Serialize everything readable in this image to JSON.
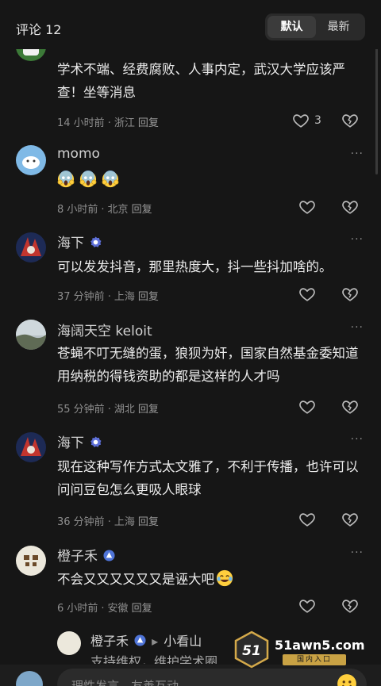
{
  "header": {
    "title": "评论 12",
    "sort_active": "默认",
    "sort_other": "最新"
  },
  "comments": [
    {
      "name": "",
      "text": "学术不端、经费腐败、人事内定，武汉大学应该严查！坐等消息",
      "time": "14 小时前",
      "location": "浙江",
      "reply": "回复",
      "likes": "3"
    },
    {
      "name": "momo",
      "text": "",
      "time": "8 小时前",
      "location": "北京",
      "reply": "回复",
      "emoji": [
        "scream-emoji",
        "scream-emoji",
        "scream-emoji"
      ]
    },
    {
      "name": "海下",
      "text": "可以发发抖音，那里热度大，抖一些抖加啥的。",
      "time": "37 分钟前",
      "location": "上海",
      "reply": "回复"
    },
    {
      "name": "海阔天空 keloit",
      "text": "苍蝇不叮无缝的蛋，狼狈为奸，国家自然基金委知道用纳税的得钱资助的都是这样的人才吗",
      "time": "55 分钟前",
      "location": "湖北",
      "reply": "回复"
    },
    {
      "name": "海下",
      "text": "现在这种写作方式太文雅了，不利于传播，也许可以问问豆包怎么更吸人眼球",
      "time": "36 分钟前",
      "location": "上海",
      "reply": "回复"
    },
    {
      "name": "橙子禾",
      "text": "不会又又又又又又是诬大吧",
      "time": "6 小时前",
      "location": "安徽",
      "reply": "回复",
      "emoji": [
        "laughing-tears-emoji"
      ]
    }
  ],
  "reply_preview": {
    "name": "橙子禾",
    "arrow": "▸",
    "target": "小看山",
    "text": "支持维权，维护学术圈"
  },
  "input": {
    "placeholder": "理性发言，友善互动"
  },
  "watermark": {
    "site": "51awn5.com",
    "sub": "国内入口",
    "logo": "51"
  },
  "colors": {
    "background": "#161616",
    "text": "#ececec",
    "meta": "#8d8d8d",
    "badge": "#5d6fd8"
  }
}
